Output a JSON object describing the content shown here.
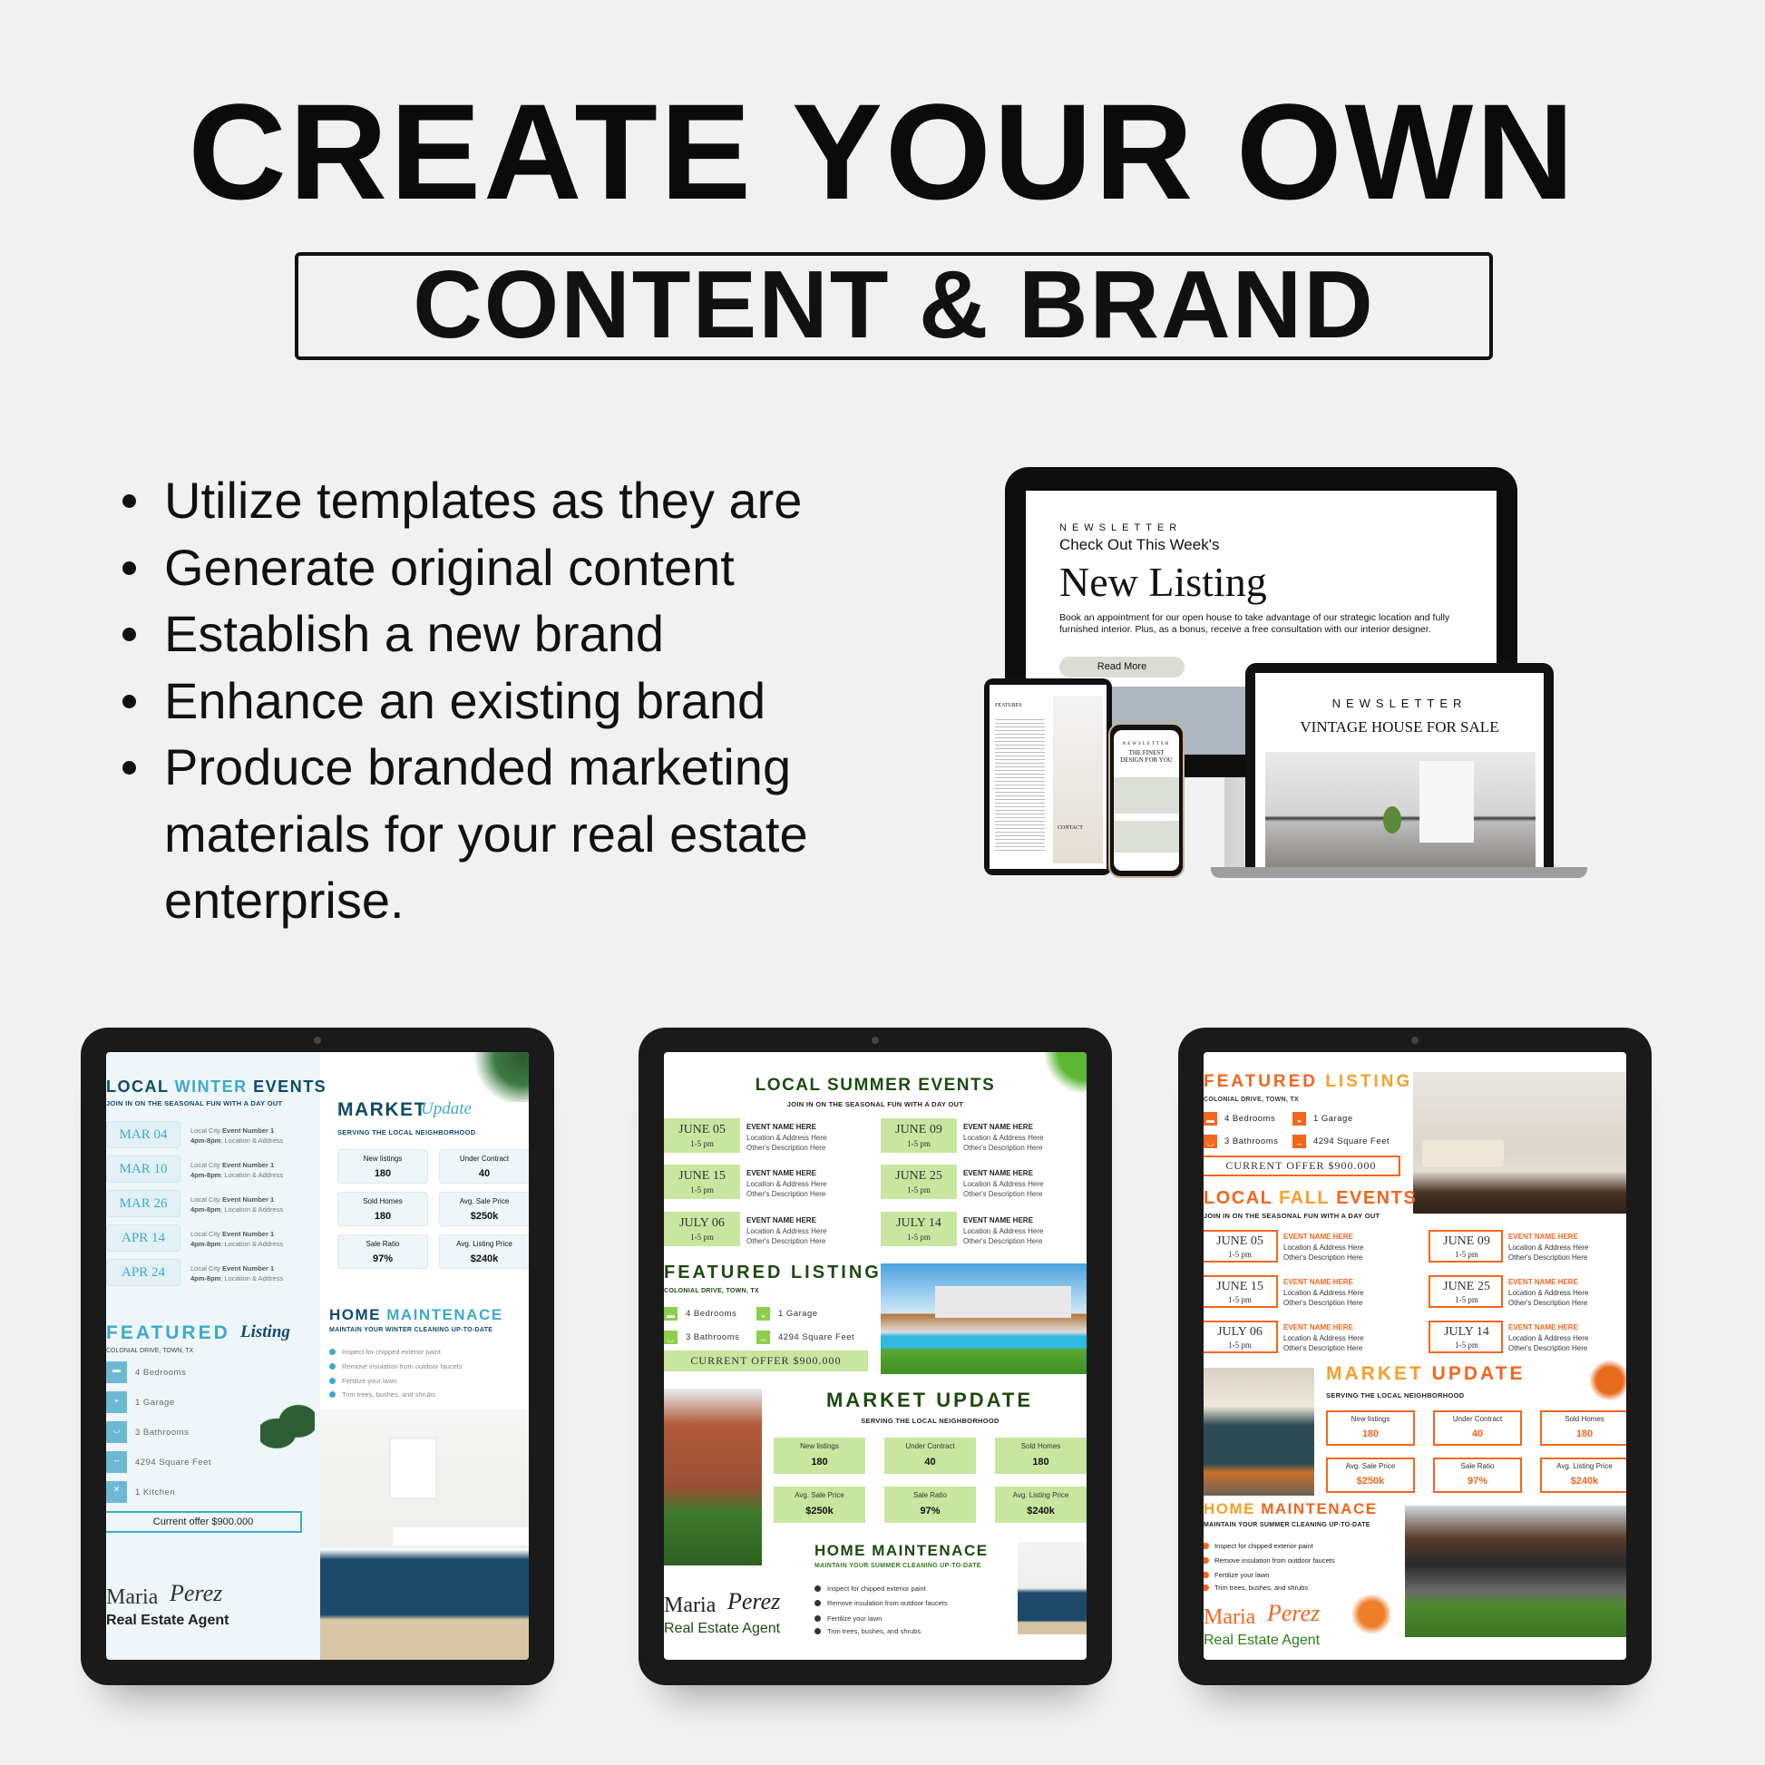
{
  "headline": "CREATE YOUR OWN",
  "subheadline": "CONTENT & BRAND",
  "bullets": [
    "Utilize templates as they are",
    "Generate original content",
    "Establish a new brand",
    "Enhance an existing brand",
    "Produce branded marketing materials for your real estate enterprise."
  ],
  "monitor": {
    "eyebrow": "NEWSLETTER",
    "kicker": "Check Out This Week's",
    "title": "New Listing",
    "body": "Book an appointment for our open house to take advantage of our strategic location and fully furnished interior. Plus, as a bonus, receive a free consultation with our interior designer.",
    "button": "Read More"
  },
  "laptop": {
    "eyebrow": "NEWSLETTER",
    "title": "VINTAGE HOUSE FOR SALE"
  },
  "small_tablet": {
    "heading": "FEATURES",
    "contact": "CONTACT"
  },
  "phone": {
    "eyebrow": "NEWSLETTER",
    "title": "THE FINEST DESIGN FOR YOU"
  },
  "colors": {
    "winter": "#3fa9c9",
    "winter_dark": "#0f4a6b",
    "summer": "#c8e6a0",
    "summer_dark": "#1d4a10",
    "fall": "#f2661e",
    "fall_light": "#f5a02a"
  },
  "agent": {
    "first": "Maria",
    "last": "Perez",
    "role": "Real Estate Agent"
  },
  "winter": {
    "events_title": [
      "LOCAL ",
      "WINTER",
      " EVENTS"
    ],
    "events_sub": "JOIN IN ON THE SEASONAL FUN WITH A DAY OUT",
    "events": [
      {
        "date": "MAR 04",
        "l1a": "Local City ",
        "l1b": "Event Number 1",
        "l2a": "4pm-8pm",
        "l2b": "; Location & Address"
      },
      {
        "date": "MAR 10",
        "l1a": "Local City ",
        "l1b": "Event Number 1",
        "l2a": "4pm-8pm",
        "l2b": "; Location & Address"
      },
      {
        "date": "MAR 26",
        "l1a": "Local City ",
        "l1b": "Event Number 1",
        "l2a": "4pm-8pm",
        "l2b": "; Location & Address"
      },
      {
        "date": "APR 14",
        "l1a": "Local City ",
        "l1b": "Event Number 1",
        "l2a": "4pm-8pm",
        "l2b": "; Location & Address"
      },
      {
        "date": "APR 24",
        "l1a": "Local City ",
        "l1b": "Event Number 1",
        "l2a": "4pm-8pm",
        "l2b": "; Location & Address"
      }
    ],
    "market_title": "MARKET",
    "market_script": "Update",
    "market_sub": "SERVING THE LOCAL NEIGHBORHOOD",
    "stats": [
      {
        "label": "New listings",
        "value": "180"
      },
      {
        "label": "Under Contract",
        "value": "40"
      },
      {
        "label": "Sold Homes",
        "value": "180"
      },
      {
        "label": "Avg. Sale Price",
        "value": "$250k"
      },
      {
        "label": "Sale Ratio",
        "value": "97%"
      },
      {
        "label": "Avg. Listing Price",
        "value": "$240k"
      }
    ],
    "maint_title": [
      "HOME ",
      "MAINTENACE"
    ],
    "maint_sub": "MAINTAIN YOUR WINTER CLEANING UP-TO-DATE",
    "maint": [
      "Inspect for chipped exterior paint",
      "Remove insulation from outdoor faucets",
      "Fertilize your lawn",
      "Trim trees, bushes, and shrubs"
    ],
    "featured_title": "FEATURED",
    "featured_script": "Listing",
    "address": "COLONIAL DRIVE, TOWN, TX",
    "features": [
      {
        "icon": "bed-icon",
        "text": "4 Bedrooms"
      },
      {
        "icon": "car-icon",
        "text": "1 Garage"
      },
      {
        "icon": "bathtub-icon",
        "text": "3 Bathrooms"
      },
      {
        "icon": "arrows-icon",
        "text": "4294 Square Feet"
      },
      {
        "icon": "utensils-icon",
        "text": "1 Kitchen"
      }
    ],
    "offer": "Current offer $900.000"
  },
  "summer": {
    "events_title": "LOCAL SUMMER EVENTS",
    "events_sub": "JOIN IN ON THE SEASONAL FUN WITH A DAY OUT",
    "events": [
      {
        "date": "JUNE 05",
        "time": "1-5 pm",
        "name": "EVENT NAME HERE",
        "loc": "Location & Address Here",
        "desc": "Other's Description Here"
      },
      {
        "date": "JUNE 09",
        "time": "1-5 pm",
        "name": "EVENT NAME HERE",
        "loc": "Location & Address Here",
        "desc": "Other's Description Here"
      },
      {
        "date": "JUNE 15",
        "time": "1-5 pm",
        "name": "EVENT NAME HERE",
        "loc": "Location & Address Here",
        "desc": "Other's Description Here"
      },
      {
        "date": "JUNE 25",
        "time": "1-5 pm",
        "name": "EVENT NAME HERE",
        "loc": "Location & Address Here",
        "desc": "Other's Description Here"
      },
      {
        "date": "JULY 06",
        "time": "1-5 pm",
        "name": "EVENT NAME HERE",
        "loc": "Location & Address Here",
        "desc": "Other's Description Here"
      },
      {
        "date": "JULY 14",
        "time": "1-5 pm",
        "name": "EVENT NAME HERE",
        "loc": "Location & Address Here",
        "desc": "Other's Description Here"
      }
    ],
    "featured_title": "FEATURED LISTING",
    "address": "COLONIAL DRIVE, TOWN, TX",
    "features": [
      {
        "icon": "bed-icon",
        "text": "4 Bedrooms"
      },
      {
        "icon": "car-icon",
        "text": "1 Garage"
      },
      {
        "icon": "bathtub-icon",
        "text": "3 Bathrooms"
      },
      {
        "icon": "arrows-icon",
        "text": "4294 Square Feet"
      }
    ],
    "offer": "CURRENT OFFER $900.000",
    "market_title": "MARKET UPDATE",
    "market_sub": "SERVING THE LOCAL NEIGHBORHOOD",
    "stats": [
      {
        "label": "New listings",
        "value": "180"
      },
      {
        "label": "Under Contract",
        "value": "40"
      },
      {
        "label": "Sold Homes",
        "value": "180"
      },
      {
        "label": "Avg. Sale Price",
        "value": "$250k"
      },
      {
        "label": "Sale Ratio",
        "value": "97%"
      },
      {
        "label": "Avg. Listing Price",
        "value": "$240k"
      }
    ],
    "maint_title": "HOME MAINTENACE",
    "maint_sub": "MAINTAIN YOUR SUMMER CLEANING UP-TO-DATE",
    "maint": [
      "Inspect for chipped exterior paint",
      "Remove insulation from outdoor faucets",
      "Fertilize your lawn",
      "Trim trees, bushes, and shrubs"
    ]
  },
  "fall": {
    "featured_title": [
      "FEATURED ",
      "LISTING"
    ],
    "address": "COLONIAL DRIVE, TOWN, TX",
    "features": [
      {
        "icon": "bed-icon",
        "text": "4 Bedrooms"
      },
      {
        "icon": "car-icon",
        "text": "1 Garage"
      },
      {
        "icon": "bathtub-icon",
        "text": "3 Bathrooms"
      },
      {
        "icon": "arrows-icon",
        "text": "4294 Square Feet"
      }
    ],
    "offer": "CURRENT OFFER $900.000",
    "events_title": [
      "LOCAL ",
      "FALL",
      " EVENTS"
    ],
    "events_sub": "JOIN IN ON THE SEASONAL FUN WITH A DAY OUT",
    "events": [
      {
        "date": "JUNE 05",
        "time": "1-5 pm",
        "name": "EVENT NAME HERE",
        "loc": "Location & Address Here",
        "desc": "Other's Description Here"
      },
      {
        "date": "JUNE 09",
        "time": "1-5 pm",
        "name": "EVENT NAME HERE",
        "loc": "Location & Address Here",
        "desc": "Other's Description Here"
      },
      {
        "date": "JUNE 15",
        "time": "1-5 pm",
        "name": "EVENT NAME HERE",
        "loc": "Location & Address Here",
        "desc": "Other's Description Here"
      },
      {
        "date": "JUNE 25",
        "time": "1-5 pm",
        "name": "EVENT NAME HERE",
        "loc": "Location & Address Here",
        "desc": "Other's Description Here"
      },
      {
        "date": "JULY 06",
        "time": "1-5 pm",
        "name": "EVENT NAME HERE",
        "loc": "Location & Address Here",
        "desc": "Other's Description Here"
      },
      {
        "date": "JULY 14",
        "time": "1-5 pm",
        "name": "EVENT NAME HERE",
        "loc": "Location & Address Here",
        "desc": "Other's Description Here"
      }
    ],
    "market_title": [
      "MARKET ",
      "UPDATE"
    ],
    "market_sub": "SERVING THE LOCAL NEIGHBORHOOD",
    "stats": [
      {
        "label": "New listings",
        "value": "180"
      },
      {
        "label": "Under Contract",
        "value": "40"
      },
      {
        "label": "Sold Homes",
        "value": "180"
      },
      {
        "label": "Avg. Sale Price",
        "value": "$250k"
      },
      {
        "label": "Sale Ratio",
        "value": "97%"
      },
      {
        "label": "Avg. Listing Price",
        "value": "$240k"
      }
    ],
    "maint_title": [
      "HOME ",
      "MAINTENACE"
    ],
    "maint_sub": "MAINTAIN YOUR SUMMER CLEANING UP-TO-DATE",
    "maint": [
      "Inspect for chipped exterior paint",
      "Remove insulation from outdoor faucets",
      "Fertilize your lawn",
      "Trim trees, bushes, and shrubs"
    ]
  }
}
